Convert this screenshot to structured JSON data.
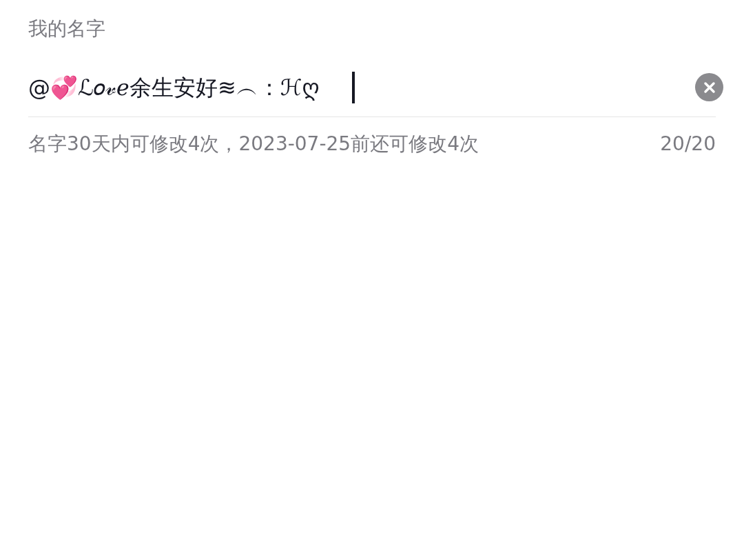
{
  "label": "我的名字",
  "name_field": {
    "value": "@💞ℒ𝑜𝓋ℯ余生安好≋︵：ℋღ",
    "focused": true
  },
  "hint": "名字30天内可修改4次，2023-07-25前还可修改4次",
  "counter": "20/20"
}
